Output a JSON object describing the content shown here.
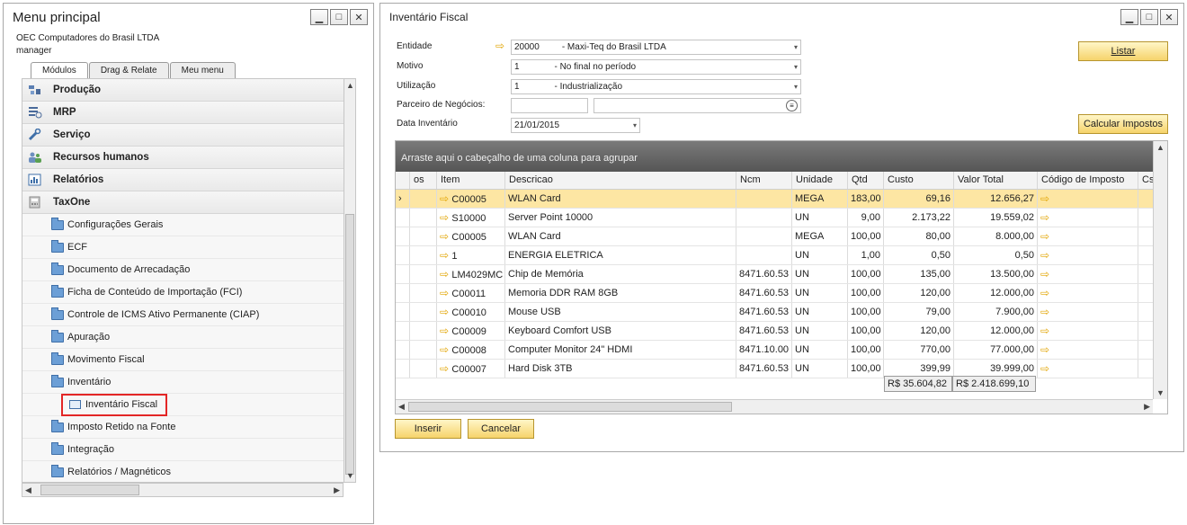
{
  "menu": {
    "title": "Menu principal",
    "company": "OEC Computadores do Brasil LTDA",
    "user": "manager",
    "tabs": [
      "Módulos",
      "Drag & Relate",
      "Meu menu"
    ],
    "modules": [
      "Produção",
      "MRP",
      "Serviço",
      "Recursos humanos",
      "Relatórios",
      "TaxOne"
    ],
    "taxone_items": [
      "Configurações Gerais",
      "ECF",
      "Documento de Arrecadação",
      "Ficha de Conteúdo de Importação (FCI)",
      "Controle de ICMS Ativo Permanente (CIAP)",
      "Apuração",
      "Movimento Fiscal",
      "Inventário"
    ],
    "inventario_child": "Inventário Fiscal",
    "taxone_items_after": [
      "Imposto Retido na Fonte",
      "Integração",
      "Relatórios / Magnéticos"
    ]
  },
  "inv": {
    "title": "Inventário Fiscal",
    "labels": {
      "entidade": "Entidade",
      "motivo": "Motivo",
      "utilizacao": "Utilização",
      "parceiro": "Parceiro de Negócios:",
      "data": "Data Inventário"
    },
    "values": {
      "entidade": "20000         - Maxi-Teq do Brasil LTDA",
      "motivo": "1              - No final no período",
      "utilizacao": "1              - Industrialização",
      "data": "21/01/2015"
    },
    "buttons": {
      "listar": "Listar",
      "calcular": "Calcular Impostos",
      "inserir": "Inserir",
      "cancelar": "Cancelar"
    },
    "grid": {
      "group_hint": "Arraste aqui o cabeçalho de uma coluna para agrupar",
      "headers": [
        "",
        "os",
        "Item",
        "Descricao",
        "Ncm",
        "Unidade",
        "Qtd",
        "Custo",
        "Valor Total",
        "Código de Imposto",
        "Cs"
      ],
      "rows": [
        [
          "C00005",
          "WLAN Card",
          "",
          "MEGA",
          "183,00",
          "69,16",
          "12.656,27"
        ],
        [
          "S10000",
          "Server Point 10000",
          "",
          "UN",
          "9,00",
          "2.173,22",
          "19.559,02"
        ],
        [
          "C00005",
          "WLAN Card",
          "",
          "MEGA",
          "100,00",
          "80,00",
          "8.000,00"
        ],
        [
          "1",
          "ENERGIA ELETRICA",
          "",
          "UN",
          "1,00",
          "0,50",
          "0,50"
        ],
        [
          "LM4029MC",
          "Chip de Memória",
          "8471.60.53",
          "UN",
          "100,00",
          "135,00",
          "13.500,00"
        ],
        [
          "C00011",
          "Memoria DDR RAM 8GB",
          "8471.60.53",
          "UN",
          "100,00",
          "120,00",
          "12.000,00"
        ],
        [
          "C00010",
          "Mouse USB",
          "8471.60.53",
          "UN",
          "100,00",
          "79,00",
          "7.900,00"
        ],
        [
          "C00009",
          "Keyboard Comfort USB",
          "8471.60.53",
          "UN",
          "100,00",
          "120,00",
          "12.000,00"
        ],
        [
          "C00008",
          "Computer Monitor 24\" HDMI",
          "8471.10.00",
          "UN",
          "100,00",
          "770,00",
          "77.000,00"
        ],
        [
          "C00007",
          "Hard Disk 3TB",
          "8471.60.53",
          "UN",
          "100,00",
          "399,99",
          "39.999,00"
        ]
      ],
      "total_custo": "R$ 35.604,82",
      "total_valor": "R$ 2.418.699,10"
    }
  }
}
